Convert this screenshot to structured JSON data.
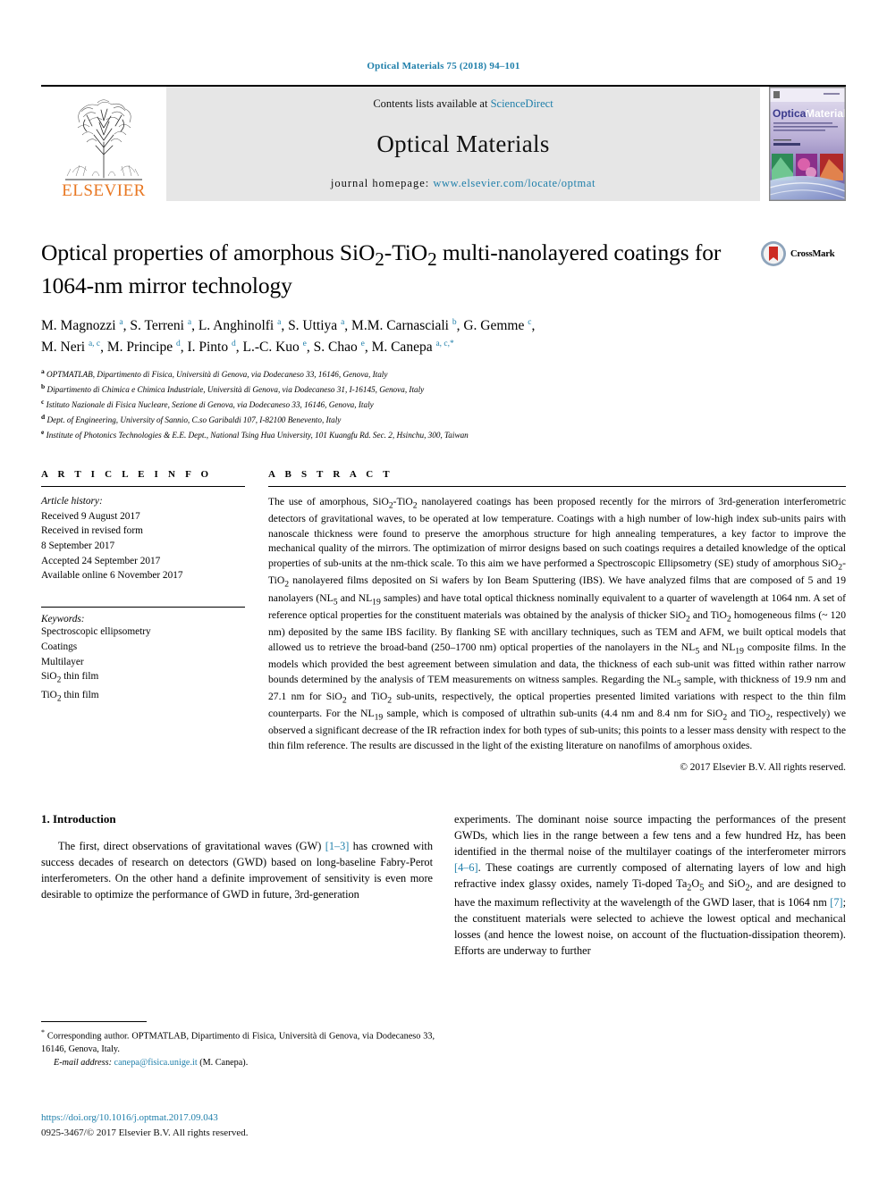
{
  "running_head": "Optical Materials 75 (2018) 94–101",
  "masthead": {
    "publisher_name": "ELSEVIER",
    "contents_line_prefix": "Contents lists available at ",
    "contents_line_link": "ScienceDirect",
    "journal_title": "Optical Materials",
    "homepage_label": "journal homepage: ",
    "homepage_url": "www.elsevier.com/locate/optmat",
    "cover_title_1": "Optical",
    "cover_title_2": "Materials"
  },
  "article": {
    "title": "Optical properties of amorphous SiO2-TiO2 multi-nanolayered coatings for 1064-nm mirror technology",
    "crossmark_label": "CrossMark",
    "authors_line_1": "M. Magnozzi a, S. Terreni a, L. Anghinolfi a, S. Uttiya a, M.M. Carnasciali b, G. Gemme c,",
    "authors_line_2": "M. Neri a, c, M. Principe d, I. Pinto d, L.-C. Kuo e, S. Chao e, M. Canepa a, c, *",
    "affiliations": [
      {
        "mark": "a",
        "text": "OPTMATLAB, Dipartimento di Fisica, Università di Genova, via Dodecaneso 33, 16146, Genova, Italy"
      },
      {
        "mark": "b",
        "text": "Dipartimento di Chimica e Chimica Industriale, Università di Genova, via Dodecaneso 31, I-16145, Genova, Italy"
      },
      {
        "mark": "c",
        "text": "Istituto Nazionale di Fisica Nucleare, Sezione di Genova, via Dodecaneso 33, 16146, Genova, Italy"
      },
      {
        "mark": "d",
        "text": "Dept. of Engineering, University of Sannio, C.so Garibaldi 107, I-82100 Benevento, Italy"
      },
      {
        "mark": "e",
        "text": "Institute of Photonics Technologies & E.E. Dept., National Tsing Hua University, 101 Kuangfu Rd. Sec. 2, Hsinchu, 300, Taiwan"
      }
    ]
  },
  "article_info": {
    "heading": "A R T I C L E   I N F O",
    "history_heading": "Article history:",
    "history": [
      "Received 9 August 2017",
      "Received in revised form",
      "8 September 2017",
      "Accepted 24 September 2017",
      "Available online 6 November 2017"
    ],
    "keywords_heading": "Keywords:",
    "keywords": [
      "Spectroscopic ellipsometry",
      "Coatings",
      "Multilayer",
      "SiO2 thin film",
      "TiO2 thin film"
    ]
  },
  "abstract": {
    "heading": "A B S T R A C T",
    "text": "The use of amorphous, SiO2-TiO2 nanolayered coatings has been proposed recently for the mirrors of 3rd-generation interferometric detectors of gravitational waves, to be operated at low temperature. Coatings with a high number of low-high index sub-units pairs with nanoscale thickness were found to preserve the amorphous structure for high annealing temperatures, a key factor to improve the mechanical quality of the mirrors. The optimization of mirror designs based on such coatings requires a detailed knowledge of the optical properties of sub-units at the nm-thick scale. To this aim we have performed a Spectroscopic Ellipsometry (SE) study of amorphous SiO2-TiO2 nanolayered films deposited on Si wafers by Ion Beam Sputtering (IBS). We have analyzed films that are composed of 5 and 19 nanolayers (NL5 and NL19 samples) and have total optical thickness nominally equivalent to a quarter of wavelength at 1064 nm. A set of reference optical properties for the constituent materials was obtained by the analysis of thicker SiO2 and TiO2 homogeneous films (~ 120 nm) deposited by the same IBS facility. By flanking SE with ancillary techniques, such as TEM and AFM, we built optical models that allowed us to retrieve the broad-band (250–1700 nm) optical properties of the nanolayers in the NL5 and NL19 composite films. In the models which provided the best agreement between simulation and data, the thickness of each sub-unit was fitted within rather narrow bounds determined by the analysis of TEM measurements on witness samples. Regarding the NL5 sample, with thickness of 19.9 nm and 27.1 nm for SiO2 and TiO2 sub-units, respectively, the optical properties presented limited variations with respect to the thin film counterparts. For the NL19 sample, which is composed of ultrathin sub-units (4.4 nm and 8.4 nm for SiO2 and TiO2, respectively) we observed a significant decrease of the IR refraction index for both types of sub-units; this points to a lesser mass density with respect to the thin film reference. The results are discussed in the light of the existing literature on nanofilms of amorphous oxides.",
    "copyright": "© 2017 Elsevier B.V. All rights reserved."
  },
  "introduction": {
    "section_number_title": "1.  Introduction",
    "left_paragraph_part1": "The first, direct observations of gravitational waves (GW) ",
    "left_citation_1": "[1–3]",
    "left_paragraph_part2": " has crowned with success decades of research on detectors (GWD) based on long-baseline Fabry-Perot interferometers. On the other hand a definite improvement of sensitivity is even more desirable to optimize the performance of GWD in future, 3rd-generation",
    "right_paragraph_part1": "experiments. The dominant noise source impacting the performances of the present GWDs, which lies in the range between a few tens and a few hundred Hz, has been identified in the thermal noise of the multilayer coatings of the interferometer mirrors ",
    "right_citation_1": "[4–6]",
    "right_paragraph_part2": ". These coatings are currently composed of alternating layers of low and high refractive index glassy oxides, namely Ti-doped Ta2O5 and SiO2, and are designed to have the maximum reflectivity at the wavelength of the GWD laser, that is 1064 nm ",
    "right_citation_2": "[7]",
    "right_paragraph_part3": "; the constituent materials were selected to achieve the lowest optical and mechanical losses (and hence the lowest noise, on account of the fluctuation-dissipation theorem). Efforts are underway to further"
  },
  "footnote": {
    "star": "*",
    "corresponding_text": " Corresponding author. OPTMATLAB, Dipartimento di Fisica, Università di Genova, via Dodecaneso 33, 16146, Genova, Italy.",
    "email_label": "E-mail address:",
    "email": "canepa@fisica.unige.it",
    "email_suffix": "(M. Canepa)."
  },
  "footer": {
    "doi": "https://doi.org/10.1016/j.optmat.2017.09.043",
    "issn_line": "0925-3467/© 2017 Elsevier B.V. All rights reserved."
  },
  "colors": {
    "link_blue": "#1f7faa",
    "elsevier_orange": "#e87722",
    "banner_gray": "#e6e6e6"
  }
}
